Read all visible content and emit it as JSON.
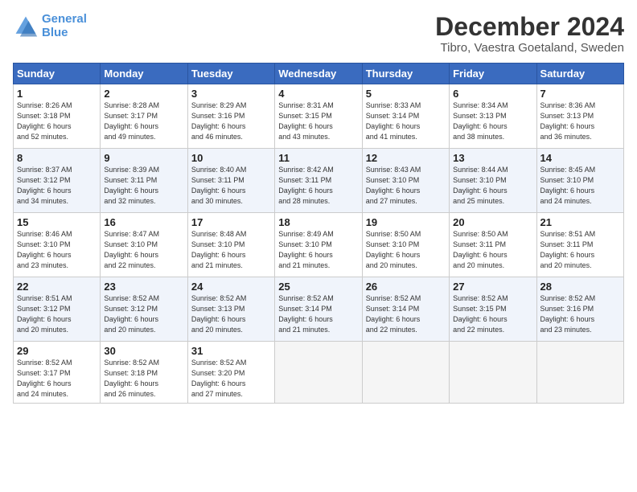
{
  "header": {
    "logo_line1": "General",
    "logo_line2": "Blue",
    "month": "December 2024",
    "location": "Tibro, Vaestra Goetaland, Sweden"
  },
  "days_of_week": [
    "Sunday",
    "Monday",
    "Tuesday",
    "Wednesday",
    "Thursday",
    "Friday",
    "Saturday"
  ],
  "weeks": [
    [
      {
        "day": "1",
        "info": "Sunrise: 8:26 AM\nSunset: 3:18 PM\nDaylight: 6 hours\nand 52 minutes."
      },
      {
        "day": "2",
        "info": "Sunrise: 8:28 AM\nSunset: 3:17 PM\nDaylight: 6 hours\nand 49 minutes."
      },
      {
        "day": "3",
        "info": "Sunrise: 8:29 AM\nSunset: 3:16 PM\nDaylight: 6 hours\nand 46 minutes."
      },
      {
        "day": "4",
        "info": "Sunrise: 8:31 AM\nSunset: 3:15 PM\nDaylight: 6 hours\nand 43 minutes."
      },
      {
        "day": "5",
        "info": "Sunrise: 8:33 AM\nSunset: 3:14 PM\nDaylight: 6 hours\nand 41 minutes."
      },
      {
        "day": "6",
        "info": "Sunrise: 8:34 AM\nSunset: 3:13 PM\nDaylight: 6 hours\nand 38 minutes."
      },
      {
        "day": "7",
        "info": "Sunrise: 8:36 AM\nSunset: 3:13 PM\nDaylight: 6 hours\nand 36 minutes."
      }
    ],
    [
      {
        "day": "8",
        "info": "Sunrise: 8:37 AM\nSunset: 3:12 PM\nDaylight: 6 hours\nand 34 minutes."
      },
      {
        "day": "9",
        "info": "Sunrise: 8:39 AM\nSunset: 3:11 PM\nDaylight: 6 hours\nand 32 minutes."
      },
      {
        "day": "10",
        "info": "Sunrise: 8:40 AM\nSunset: 3:11 PM\nDaylight: 6 hours\nand 30 minutes."
      },
      {
        "day": "11",
        "info": "Sunrise: 8:42 AM\nSunset: 3:11 PM\nDaylight: 6 hours\nand 28 minutes."
      },
      {
        "day": "12",
        "info": "Sunrise: 8:43 AM\nSunset: 3:10 PM\nDaylight: 6 hours\nand 27 minutes."
      },
      {
        "day": "13",
        "info": "Sunrise: 8:44 AM\nSunset: 3:10 PM\nDaylight: 6 hours\nand 25 minutes."
      },
      {
        "day": "14",
        "info": "Sunrise: 8:45 AM\nSunset: 3:10 PM\nDaylight: 6 hours\nand 24 minutes."
      }
    ],
    [
      {
        "day": "15",
        "info": "Sunrise: 8:46 AM\nSunset: 3:10 PM\nDaylight: 6 hours\nand 23 minutes."
      },
      {
        "day": "16",
        "info": "Sunrise: 8:47 AM\nSunset: 3:10 PM\nDaylight: 6 hours\nand 22 minutes."
      },
      {
        "day": "17",
        "info": "Sunrise: 8:48 AM\nSunset: 3:10 PM\nDaylight: 6 hours\nand 21 minutes."
      },
      {
        "day": "18",
        "info": "Sunrise: 8:49 AM\nSunset: 3:10 PM\nDaylight: 6 hours\nand 21 minutes."
      },
      {
        "day": "19",
        "info": "Sunrise: 8:50 AM\nSunset: 3:10 PM\nDaylight: 6 hours\nand 20 minutes."
      },
      {
        "day": "20",
        "info": "Sunrise: 8:50 AM\nSunset: 3:11 PM\nDaylight: 6 hours\nand 20 minutes."
      },
      {
        "day": "21",
        "info": "Sunrise: 8:51 AM\nSunset: 3:11 PM\nDaylight: 6 hours\nand 20 minutes."
      }
    ],
    [
      {
        "day": "22",
        "info": "Sunrise: 8:51 AM\nSunset: 3:12 PM\nDaylight: 6 hours\nand 20 minutes."
      },
      {
        "day": "23",
        "info": "Sunrise: 8:52 AM\nSunset: 3:12 PM\nDaylight: 6 hours\nand 20 minutes."
      },
      {
        "day": "24",
        "info": "Sunrise: 8:52 AM\nSunset: 3:13 PM\nDaylight: 6 hours\nand 20 minutes."
      },
      {
        "day": "25",
        "info": "Sunrise: 8:52 AM\nSunset: 3:14 PM\nDaylight: 6 hours\nand 21 minutes."
      },
      {
        "day": "26",
        "info": "Sunrise: 8:52 AM\nSunset: 3:14 PM\nDaylight: 6 hours\nand 22 minutes."
      },
      {
        "day": "27",
        "info": "Sunrise: 8:52 AM\nSunset: 3:15 PM\nDaylight: 6 hours\nand 22 minutes."
      },
      {
        "day": "28",
        "info": "Sunrise: 8:52 AM\nSunset: 3:16 PM\nDaylight: 6 hours\nand 23 minutes."
      }
    ],
    [
      {
        "day": "29",
        "info": "Sunrise: 8:52 AM\nSunset: 3:17 PM\nDaylight: 6 hours\nand 24 minutes."
      },
      {
        "day": "30",
        "info": "Sunrise: 8:52 AM\nSunset: 3:18 PM\nDaylight: 6 hours\nand 26 minutes."
      },
      {
        "day": "31",
        "info": "Sunrise: 8:52 AM\nSunset: 3:20 PM\nDaylight: 6 hours\nand 27 minutes."
      },
      {
        "day": "",
        "info": ""
      },
      {
        "day": "",
        "info": ""
      },
      {
        "day": "",
        "info": ""
      },
      {
        "day": "",
        "info": ""
      }
    ]
  ]
}
